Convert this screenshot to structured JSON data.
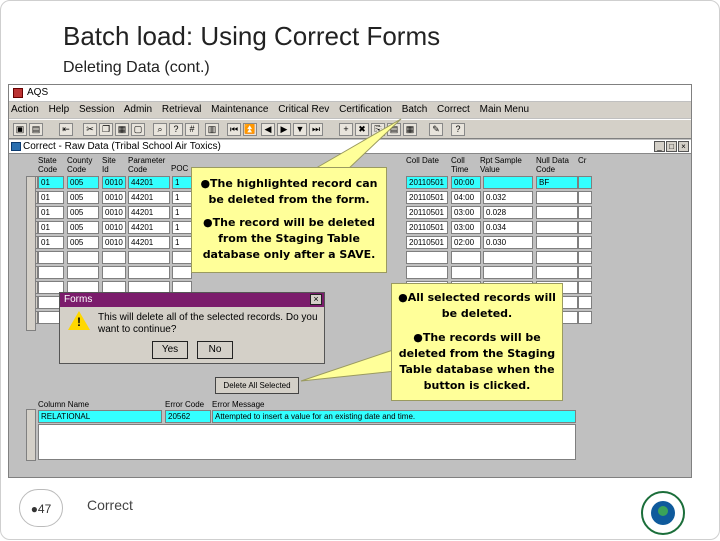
{
  "slide": {
    "title": "Batch load: Using Correct Forms",
    "subtitle": "Deleting Data (cont.)",
    "footer": "Correct",
    "page_number": "●47"
  },
  "app": {
    "title": "AQS",
    "menu": [
      "Action",
      "Help",
      "Session",
      "Admin",
      "Retrieval",
      "Maintenance",
      "Critical Rev",
      "Certification",
      "Batch",
      "Correct",
      "Main Menu"
    ],
    "toolbar_icons": [
      "save-icon",
      "print-icon",
      "exit-icon",
      "cut-icon",
      "copy-icon",
      "paste-icon",
      "clear-icon",
      "find-icon",
      "query-icon",
      "count-icon",
      "grid-icon",
      "first-icon",
      "prev-page-icon",
      "prev-icon",
      "next-icon",
      "next-page-icon",
      "last-icon",
      "insert-icon",
      "delete-icon",
      "duplicate-icon",
      "list-icon",
      "calendar-icon",
      "tools-icon",
      "help-icon"
    ],
    "toolbar_glyphs": [
      "▣",
      "▤",
      "⇤",
      "✂",
      "❐",
      "▦",
      "▢",
      "⌕",
      "?",
      "#",
      "▥",
      "⏮",
      "⏫",
      "◀",
      "▶",
      "▼",
      "⏭",
      "+",
      "✖",
      "⎘",
      "▤",
      "▦",
      "✎",
      "?"
    ]
  },
  "subwindow": {
    "title": "Correct - Raw Data (Tribal School Air Toxics)",
    "controls": [
      "_",
      "□",
      "×"
    ]
  },
  "grid": {
    "headers": [
      "State Code",
      "County Code",
      "Site Id",
      "Parameter Code",
      "POC",
      "Coll Date",
      "Coll Time",
      "Rpt Sample Value",
      "Null Data Code",
      "Cr"
    ],
    "rows_left": [
      [
        "01",
        "005",
        "0010",
        "44201",
        "1"
      ],
      [
        "01",
        "005",
        "0010",
        "44201",
        "1"
      ],
      [
        "01",
        "005",
        "0010",
        "44201",
        "1"
      ],
      [
        "01",
        "005",
        "0010",
        "44201",
        "1"
      ],
      [
        "01",
        "005",
        "0010",
        "44201",
        "1"
      ]
    ],
    "rows_right": [
      [
        "20110501",
        "00:00",
        "",
        "BF"
      ],
      [
        "20110501",
        "04:00",
        "0.032",
        ""
      ],
      [
        "20110501",
        "03:00",
        "0.028",
        ""
      ],
      [
        "20110501",
        "03:00",
        "0.034",
        ""
      ],
      [
        "20110501",
        "02:00",
        "0.030",
        ""
      ]
    ]
  },
  "callouts": {
    "form": [
      "●The highlighted record can be deleted from the form.",
      "●The record will be deleted from the Staging Table database only after a SAVE."
    ],
    "button": [
      "●All selected records will be deleted.",
      "●The records will be deleted from the Staging Table database when the button is clicked."
    ]
  },
  "dialog": {
    "title": "Forms",
    "close": "×",
    "message": "This will delete all of the selected records.  Do you want to continue?",
    "yes": "Yes",
    "no": "No"
  },
  "delete_all_button": "Delete All Selected",
  "errors": {
    "headers": [
      "Column Name",
      "Error Code",
      "Error Message"
    ],
    "row": [
      "RELATIONAL",
      "20562",
      "Attempted to insert a value for an existing date and time."
    ]
  }
}
